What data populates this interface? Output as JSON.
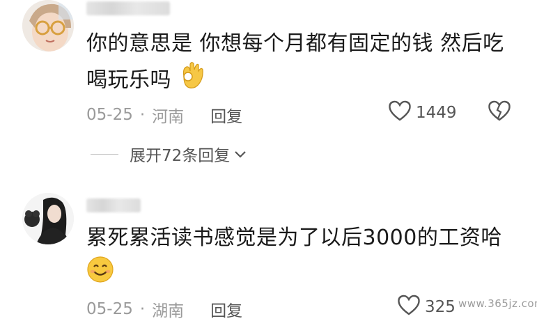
{
  "comments": [
    {
      "text": "你的意思是 你想每个月都有固定的钱 然后吃喝玩乐吗",
      "emoji": "ok-hand-emoji",
      "date": "05-25",
      "location": "河南",
      "reply_label": "回复",
      "likes": "1449",
      "expand_label": "展开72条回复"
    },
    {
      "text": "累死累活读书感觉是为了以后3000的工资哈",
      "emoji": "smiling-face-emoji",
      "date": "05-25",
      "location": "湖南",
      "reply_label": "回复",
      "likes": "325"
    }
  ],
  "separator": "·",
  "watermark": "www.365jz.com",
  "colors": {
    "text": "#1a1a1a",
    "meta": "#9a9a9a",
    "action": "#555555",
    "background": "#ffffff"
  }
}
